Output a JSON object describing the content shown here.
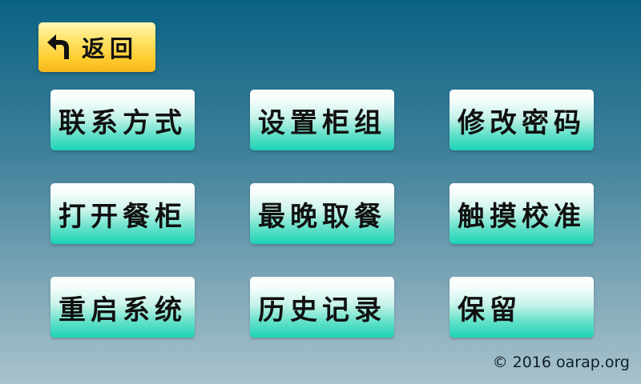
{
  "back": {
    "label": "返回"
  },
  "menu": {
    "items": [
      {
        "id": "contact",
        "label": "联系方式"
      },
      {
        "id": "set-cabinet-group",
        "label": "设置柜组"
      },
      {
        "id": "change-password",
        "label": "修改密码"
      },
      {
        "id": "open-cabinet",
        "label": "打开餐柜"
      },
      {
        "id": "latest-pickup",
        "label": "最晚取餐"
      },
      {
        "id": "touch-calibration",
        "label": "触摸校准"
      },
      {
        "id": "restart-system",
        "label": "重启系统"
      },
      {
        "id": "history",
        "label": "历史记录"
      },
      {
        "id": "reserved",
        "label": "保留"
      }
    ]
  },
  "footer": {
    "copyright": "© 2016 oarap.org"
  },
  "colors": {
    "back_button": "#ffcb2c",
    "tile": "#1dd3b6",
    "background_top": "#0a6283",
    "background_bottom": "#a9c2cb"
  },
  "icons": {
    "back": "undo-arrow-icon"
  }
}
